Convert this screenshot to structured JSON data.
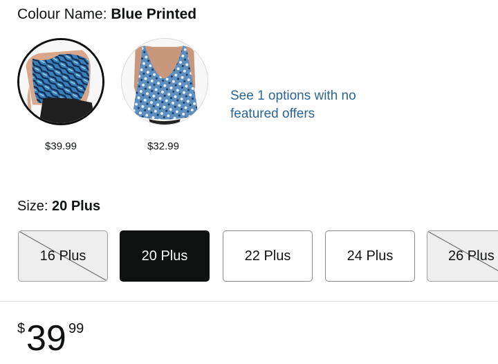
{
  "colour": {
    "label": "Colour Name: ",
    "value": "Blue Printed"
  },
  "swatches": [
    {
      "price": "$39.99",
      "selected": true
    },
    {
      "price": "$32.99",
      "selected": false
    }
  ],
  "no_offers_link": "See 1 options with no featured offers",
  "size": {
    "label": "Size: ",
    "value": "20 Plus"
  },
  "size_options": [
    {
      "label": "16 Plus",
      "state": "unavailable"
    },
    {
      "label": "20 Plus",
      "state": "selected"
    },
    {
      "label": "22 Plus",
      "state": "available"
    },
    {
      "label": "24 Plus",
      "state": "available"
    },
    {
      "label": "26 Plus",
      "state": "unavailable"
    }
  ],
  "price": {
    "symbol": "$",
    "whole": "39",
    "fraction": "99"
  },
  "colors": {
    "link": "#2a6496",
    "selected_bg": "#0f1111",
    "unavailable_bg": "#eeeeee"
  }
}
